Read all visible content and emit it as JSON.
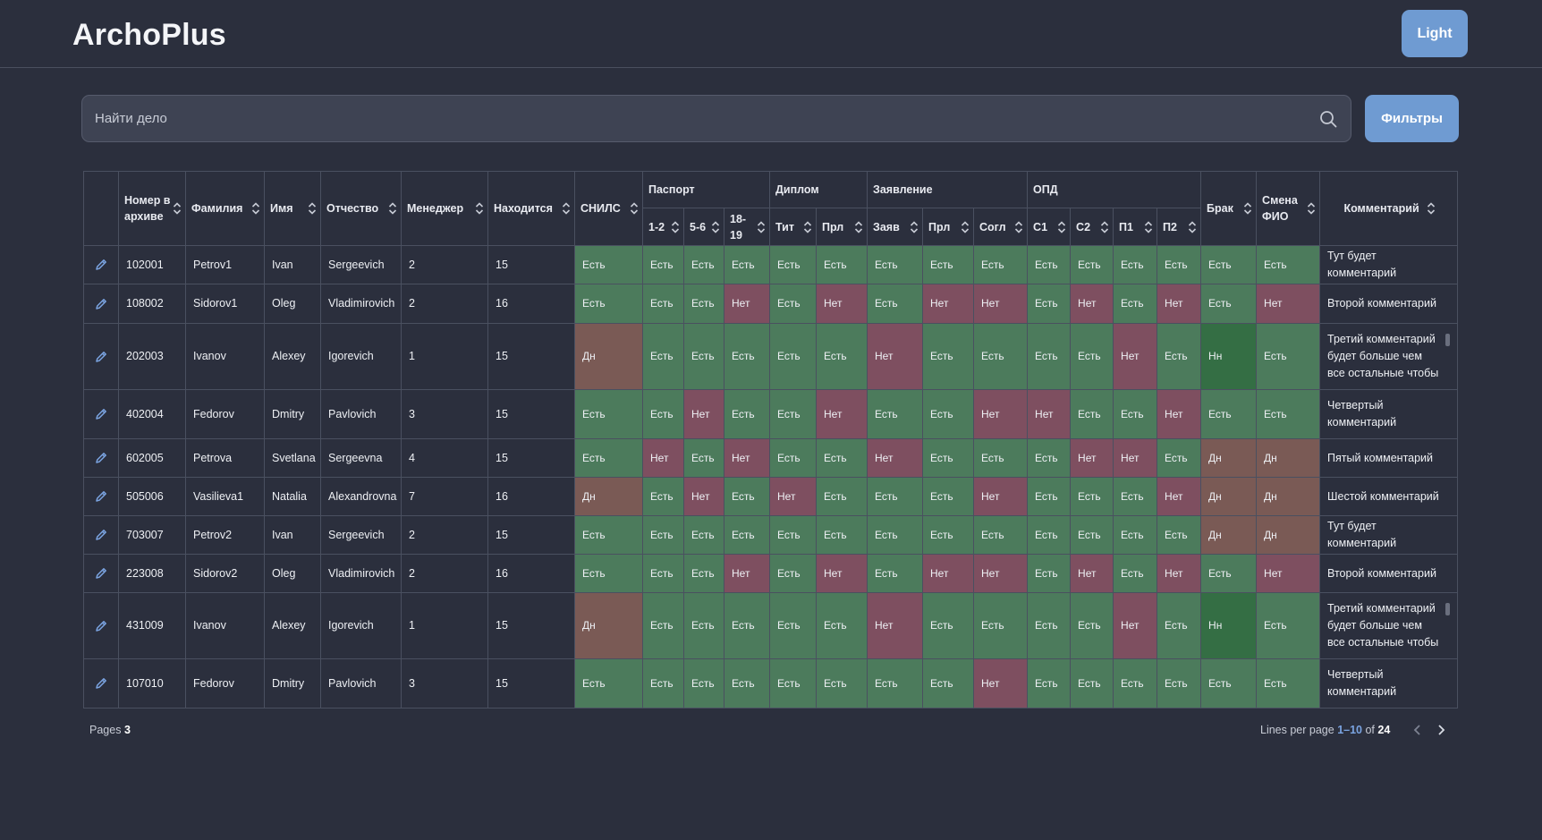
{
  "app": {
    "title": "ArchoPlus",
    "theme_button": "Light"
  },
  "search": {
    "placeholder": "Найти дело",
    "filters_button": "Фильтры"
  },
  "table": {
    "columns": {
      "archive_no": "Номер в архиве",
      "last_name": "Фамилия",
      "first_name": "Имя",
      "patronymic": "Отчество",
      "manager": "Менеджер",
      "location": "Находится",
      "snils": "СНИЛС",
      "passport": "Паспорт",
      "p12": "1-2",
      "p56": "5-6",
      "p1819": "18-19",
      "diploma": "Диплом",
      "tit": "Тит",
      "prl": "Прл",
      "application": "Заявление",
      "zayav": "Заяв",
      "aprl": "Прл",
      "sogl": "Согл",
      "opd": "ОПД",
      "c1": "C1",
      "c2": "C2",
      "p1": "П1",
      "p2": "П2",
      "brak": "Брак",
      "name_change": "Смена ФИО",
      "comment": "Комментарий"
    },
    "rows": [
      {
        "archive_no": "102001",
        "last_name": "Petrov1",
        "first_name": "Ivan",
        "patronymic": "Sergeevich",
        "manager": "2",
        "location": "15",
        "snils": "Есть",
        "p12": "Есть",
        "p56": "Есть",
        "p1819": "Есть",
        "tit": "Есть",
        "prl": "Есть",
        "zayav": "Есть",
        "aprl": "Есть",
        "sogl": "Есть",
        "c1": "Есть",
        "c2": "Есть",
        "p1": "Есть",
        "p2": "Есть",
        "brak": "Есть",
        "name_change": "Есть",
        "comment": "Тут будет комментарий"
      },
      {
        "archive_no": "108002",
        "last_name": "Sidorov1",
        "first_name": "Oleg",
        "patronymic": "Vladimirovich",
        "manager": "2",
        "location": "16",
        "snils": "Есть",
        "p12": "Есть",
        "p56": "Есть",
        "p1819": "Нет",
        "tit": "Есть",
        "prl": "Нет",
        "zayav": "Есть",
        "aprl": "Нет",
        "sogl": "Нет",
        "c1": "Есть",
        "c2": "Нет",
        "p1": "Есть",
        "p2": "Нет",
        "brak": "Есть",
        "name_change": "Нет",
        "comment": "Второй комментарий"
      },
      {
        "archive_no": "202003",
        "last_name": "Ivanov",
        "first_name": "Alexey",
        "patronymic": "Igorevich",
        "manager": "1",
        "location": "15",
        "snils": "Дн",
        "p12": "Есть",
        "p56": "Есть",
        "p1819": "Есть",
        "tit": "Есть",
        "prl": "Есть",
        "zayav": "Нет",
        "aprl": "Есть",
        "sogl": "Есть",
        "c1": "Есть",
        "c2": "Есть",
        "p1": "Нет",
        "p2": "Есть",
        "brak": "Нн",
        "name_change": "Есть",
        "comment": "Третий комментарий будет больше чем все остальные чтобы"
      },
      {
        "archive_no": "402004",
        "last_name": "Fedorov",
        "first_name": "Dmitry",
        "patronymic": "Pavlovich",
        "manager": "3",
        "location": "15",
        "snils": "Есть",
        "p12": "Есть",
        "p56": "Нет",
        "p1819": "Есть",
        "tit": "Есть",
        "prl": "Нет",
        "zayav": "Есть",
        "aprl": "Есть",
        "sogl": "Нет",
        "c1": "Нет",
        "c2": "Есть",
        "p1": "Есть",
        "p2": "Нет",
        "brak": "Есть",
        "name_change": "Есть",
        "comment": "Четвертый комментарий"
      },
      {
        "archive_no": "602005",
        "last_name": "Petrova",
        "first_name": "Svetlana",
        "patronymic": "Sergeevna",
        "manager": "4",
        "location": "15",
        "snils": "Есть",
        "p12": "Нет",
        "p56": "Есть",
        "p1819": "Нет",
        "tit": "Есть",
        "prl": "Есть",
        "zayav": "Нет",
        "aprl": "Есть",
        "sogl": "Есть",
        "c1": "Есть",
        "c2": "Нет",
        "p1": "Нет",
        "p2": "Есть",
        "brak": "Дн",
        "name_change": "Дн",
        "comment": "Пятый комментарий"
      },
      {
        "archive_no": "505006",
        "last_name": "Vasilieva1",
        "first_name": "Natalia",
        "patronymic": "Alexandrovna",
        "manager": "7",
        "location": "16",
        "snils": "Дн",
        "p12": "Есть",
        "p56": "Нет",
        "p1819": "Есть",
        "tit": "Нет",
        "prl": "Есть",
        "zayav": "Есть",
        "aprl": "Есть",
        "sogl": "Нет",
        "c1": "Есть",
        "c2": "Есть",
        "p1": "Есть",
        "p2": "Нет",
        "brak": "Дн",
        "name_change": "Дн",
        "comment": "Шестой комментарий"
      },
      {
        "archive_no": "703007",
        "last_name": "Petrov2",
        "first_name": "Ivan",
        "patronymic": "Sergeevich",
        "manager": "2",
        "location": "15",
        "snils": "Есть",
        "p12": "Есть",
        "p56": "Есть",
        "p1819": "Есть",
        "tit": "Есть",
        "prl": "Есть",
        "zayav": "Есть",
        "aprl": "Есть",
        "sogl": "Есть",
        "c1": "Есть",
        "c2": "Есть",
        "p1": "Есть",
        "p2": "Есть",
        "brak": "Дн",
        "name_change": "Дн",
        "comment": "Тут будет комментарий"
      },
      {
        "archive_no": "223008",
        "last_name": "Sidorov2",
        "first_name": "Oleg",
        "patronymic": "Vladimirovich",
        "manager": "2",
        "location": "16",
        "snils": "Есть",
        "p12": "Есть",
        "p56": "Есть",
        "p1819": "Нет",
        "tit": "Есть",
        "prl": "Нет",
        "zayav": "Есть",
        "aprl": "Нет",
        "sogl": "Нет",
        "c1": "Есть",
        "c2": "Нет",
        "p1": "Есть",
        "p2": "Нет",
        "brak": "Есть",
        "name_change": "Нет",
        "comment": "Второй комментарий"
      },
      {
        "archive_no": "431009",
        "last_name": "Ivanov",
        "first_name": "Alexey",
        "patronymic": "Igorevich",
        "manager": "1",
        "location": "15",
        "snils": "Дн",
        "p12": "Есть",
        "p56": "Есть",
        "p1819": "Есть",
        "tit": "Есть",
        "prl": "Есть",
        "zayav": "Нет",
        "aprl": "Есть",
        "sogl": "Есть",
        "c1": "Есть",
        "c2": "Есть",
        "p1": "Нет",
        "p2": "Есть",
        "brak": "Нн",
        "name_change": "Есть",
        "comment": "Третий комментарий будет больше чем все остальные чтобы"
      },
      {
        "archive_no": "107010",
        "last_name": "Fedorov",
        "first_name": "Dmitry",
        "patronymic": "Pavlovich",
        "manager": "3",
        "location": "15",
        "snils": "Есть",
        "p12": "Есть",
        "p56": "Есть",
        "p1819": "Есть",
        "tit": "Есть",
        "prl": "Есть",
        "zayav": "Есть",
        "aprl": "Есть",
        "sogl": "Нет",
        "c1": "Есть",
        "c2": "Есть",
        "p1": "Есть",
        "p2": "Есть",
        "brak": "Есть",
        "name_change": "Есть",
        "comment": "Четвертый комментарий"
      }
    ]
  },
  "footer": {
    "pages_label": "Pages",
    "pages_value": "3",
    "lines_label": "Lines per page",
    "lines_range": "1–10",
    "of_label": "of",
    "total": "24"
  },
  "status_colors": {
    "Есть": "#4c7b5c",
    "Нет": "#7e4f60",
    "Дн": "#7a5a55",
    "Нн": "#346e44"
  },
  "icons": {
    "search": "search-icon",
    "edit": "pencil-icon",
    "sort": "sort-icon",
    "prev": "chevron-left-icon",
    "next": "chevron-right-icon"
  }
}
